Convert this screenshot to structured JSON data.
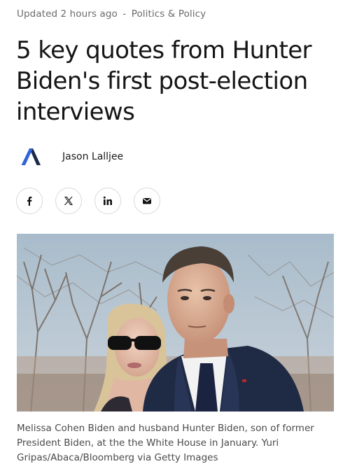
{
  "article": {
    "updated": "Updated 2 hours ago",
    "separator": "-",
    "category": "Politics & Policy",
    "headline": "5 key quotes from Hunter Biden's first post-election interviews",
    "author": "Jason Lalljee",
    "caption": "Melissa Cohen Biden and husband Hunter Biden, son of former President Biden, at the the White House in January. Yuri Gripas/Abaca/Bloomberg via Getty Images"
  },
  "share": {
    "icons": [
      "facebook-icon",
      "x-icon",
      "linkedin-icon",
      "email-icon"
    ]
  },
  "colors": {
    "accent_blue": "#2f63d6",
    "logo_dark": "#1b2a4a",
    "meta_text": "#6b6b6b"
  }
}
